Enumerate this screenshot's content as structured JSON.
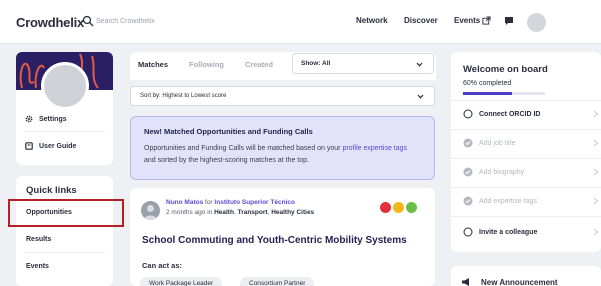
{
  "header": {
    "logo": "Crowdhelix",
    "search_placeholder": "Search Crowdhelix",
    "nav": [
      "Network",
      "Discover",
      "Events"
    ],
    "icons": [
      "search-icon",
      "external-link-icon",
      "chat-icon",
      "user-avatar"
    ]
  },
  "profile": {
    "menu": [
      {
        "label": "Settings",
        "icon": "gear-icon"
      },
      {
        "label": "User Guide",
        "icon": "book-icon"
      }
    ]
  },
  "quick_links": {
    "title": "Quick links",
    "items": [
      "Opportunities",
      "Results",
      "Events"
    ],
    "highlighted": "Opportunities",
    "highlight_color": "#b21f24"
  },
  "feed": {
    "tabs": [
      "Matches",
      "Following",
      "Created"
    ],
    "active_tab": "Matches",
    "show_filter": "Show: All",
    "sort": "Sort by: Highest to Lowest score",
    "banner": {
      "title": "New! Matched Opportunities and Funding Calls",
      "text_before": "Opportunities and Funding Calls will be matched based on your ",
      "text_link": "profile expertise tags",
      "text_after": " and sorted by the highest-scoring matches at the top."
    },
    "post": {
      "author": "Nuno Matos",
      "for_word": "for",
      "institution": "Instituto Superior Técnico",
      "time_ago": "2 months ago in",
      "tags": [
        "Health",
        "Transport",
        "Healthy Cities"
      ],
      "title": "School Commuting and Youth-Centric Mobility Systems",
      "act_as_label": "Can act as:",
      "roles": [
        "Work Package Leader",
        "Consortium Partner"
      ],
      "badge_colors": [
        "#e0303a",
        "#f2b619",
        "#6bbd45"
      ]
    }
  },
  "welcome": {
    "title": "Welcome on board",
    "progress_text": "60% completed",
    "progress": 0.6,
    "accent": "#4b3dc2",
    "items": [
      {
        "label": "Connect ORCID ID",
        "done": false
      },
      {
        "label": "Add job title",
        "done": true
      },
      {
        "label": "Add biography",
        "done": true
      },
      {
        "label": "Add expertise tags",
        "done": true
      },
      {
        "label": "Invite a colleague",
        "done": false
      }
    ]
  },
  "announcement": {
    "label": "New Announcement",
    "icon": "megaphone-icon"
  }
}
